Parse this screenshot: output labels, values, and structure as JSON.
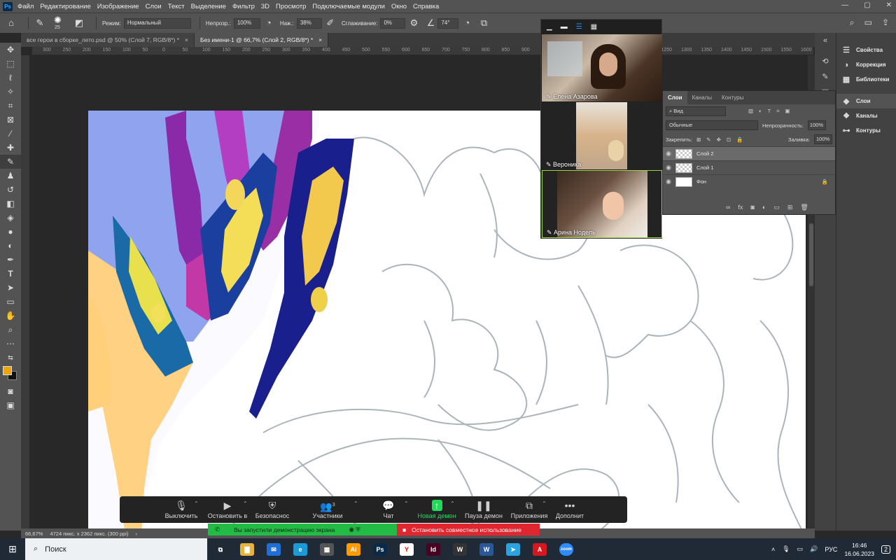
{
  "menu": {
    "logo": "Ps",
    "items": [
      "Файл",
      "Редактирование",
      "Изображение",
      "Слои",
      "Текст",
      "Выделение",
      "Фильтр",
      "3D",
      "Просмотр",
      "Подключаемые модули",
      "Окно",
      "Справка"
    ],
    "window_buttons": [
      "—",
      "▢",
      "✕"
    ]
  },
  "options": {
    "brush_size": "25",
    "mode_label": "Режим:",
    "mode_value": "Нормальный",
    "opacity_label": "Непрозр.:",
    "opacity_value": "100%",
    "pressure_label": "Наж.:",
    "pressure_value": "38%",
    "smoothing_label": "Сглаживание:",
    "smoothing_value": "0%",
    "angle_value": "74°"
  },
  "tabs": [
    {
      "label": "все герои в сборке_лето.psd @ 50% (Слой 7, RGB/8*) *",
      "close": "×"
    },
    {
      "label": "Без имени-1 @ 66,7% (Слой 2, RGB/8*) *",
      "close": "×"
    }
  ],
  "ruler_ticks": [
    "400",
    "350",
    "300",
    "250",
    "200",
    "150",
    "100",
    "50",
    "0",
    "50",
    "100",
    "150",
    "200",
    "250",
    "300",
    "350",
    "400",
    "450",
    "500",
    "550",
    "600",
    "650",
    "700",
    "750",
    "800",
    "850",
    "900",
    "950",
    "1000",
    "1050",
    "1100",
    "1150",
    "1200",
    "1250",
    "1300",
    "1350",
    "1400",
    "1450",
    "1500",
    "1550",
    "1600",
    "1650",
    "1700",
    "1750",
    "1800",
    "1850",
    "1900",
    "1950",
    "2000"
  ],
  "status": {
    "zoom": "66,67%",
    "doc_info": "4724 пикс. x 2362 пикс. (300 ppi)"
  },
  "right_panel": {
    "items": [
      {
        "label": "Свойства",
        "icon": "properties-icon"
      },
      {
        "label": "Коррекция",
        "icon": "adjustments-icon"
      },
      {
        "label": "Библиотеки",
        "icon": "libraries-icon"
      },
      {
        "label": "Слои",
        "icon": "layers-icon"
      },
      {
        "label": "Каналы",
        "icon": "channels-icon"
      },
      {
        "label": "Контуры",
        "icon": "paths-icon"
      }
    ]
  },
  "layers_panel": {
    "tabs": [
      "Слои",
      "Каналы",
      "Контуры"
    ],
    "filter_kind": "Вид",
    "blend_mode": "Обычные",
    "opacity_label": "Непрозрачность:",
    "opacity_value": "100%",
    "lock_label": "Закрепить:",
    "fill_label": "Заливка:",
    "fill_value": "100%",
    "layers": [
      {
        "name": "Слой 2",
        "selected": true
      },
      {
        "name": "Слой 1",
        "selected": false
      },
      {
        "name": "Фон",
        "selected": false
      }
    ]
  },
  "video": {
    "participants": [
      "Елена Азарова",
      "Вероника",
      "Арина Нодель"
    ]
  },
  "zoom_toolbar": {
    "buttons": [
      {
        "label": "Выключить",
        "icon": "microphone-icon"
      },
      {
        "label": "Остановить в",
        "icon": "video-camera-icon"
      },
      {
        "label": "Безопаснос",
        "icon": "shield-icon"
      },
      {
        "label": "Участники",
        "icon": "participants-icon",
        "badge": "3"
      },
      {
        "label": "Чат",
        "icon": "chat-icon"
      },
      {
        "label": "Новая демон",
        "icon": "share-screen-icon"
      },
      {
        "label": "Пауза демон",
        "icon": "pause-icon"
      },
      {
        "label": "Приложения",
        "icon": "apps-icon"
      },
      {
        "label": "Дополнит",
        "icon": "more-icon"
      }
    ],
    "share_notice": "Вы запустили демонстрацию экрана",
    "stop_share": "Остановить совместное использование"
  },
  "taskbar": {
    "search_placeholder": "Поиск",
    "language": "РУС",
    "time": "16:46",
    "date": "16.06.2023",
    "notifications": "2",
    "apps": [
      {
        "name": "explorer",
        "glyph": "▇",
        "color": "#e6b33c"
      },
      {
        "name": "mail",
        "glyph": "✉",
        "color": "#1f6fd6"
      },
      {
        "name": "edge",
        "glyph": "e",
        "color": "#1a9bd7"
      },
      {
        "name": "calculator",
        "glyph": "▦",
        "color": "#555555"
      },
      {
        "name": "illustrator",
        "glyph": "Ai",
        "color": "#ff9a00"
      },
      {
        "name": "photoshop",
        "glyph": "Ps",
        "color": "#0b2a4a"
      },
      {
        "name": "yandex",
        "glyph": "Y",
        "color": "#ffffff"
      },
      {
        "name": "indesign",
        "glyph": "Id",
        "color": "#49021f"
      },
      {
        "name": "app-w",
        "glyph": "W",
        "color": "#333333"
      },
      {
        "name": "word",
        "glyph": "W",
        "color": "#2b5797"
      },
      {
        "name": "telegram",
        "glyph": "➤",
        "color": "#2aa3e0"
      },
      {
        "name": "acrobat",
        "glyph": "A",
        "color": "#d7171f"
      },
      {
        "name": "zoom",
        "glyph": "zoom",
        "color": "#2d8cff"
      }
    ]
  }
}
